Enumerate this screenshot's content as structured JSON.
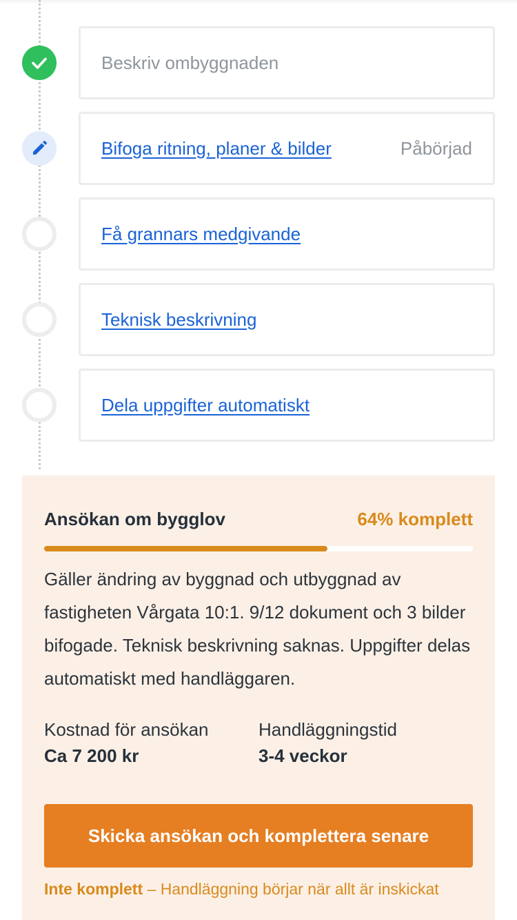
{
  "steps": [
    {
      "title": "Beskriv ombyggnaden",
      "status": "",
      "state": "done"
    },
    {
      "title": "Bifoga ritning, planer & bilder",
      "status": "Påbörjad",
      "state": "active"
    },
    {
      "title": "Få grannars medgivande",
      "status": "",
      "state": "todo"
    },
    {
      "title": "Teknisk beskrivning",
      "status": "",
      "state": "todo"
    },
    {
      "title": "Dela uppgifter automatiskt",
      "status": "",
      "state": "todo"
    }
  ],
  "summary": {
    "title": "Ansökan om bygglov",
    "percent_label": "64% komplett",
    "progress": 0.66,
    "description": "Gäller ändring av byggnad och utbyggnad av fastigheten Vårgata 10:1. 9/12 dokument och 3 bilder bifogade. Teknisk beskrivning saknas. Uppgifter delas automatiskt med handläggaren.",
    "cost_label": "Kostnad för ansökan",
    "cost_value": "Ca 7 200 kr",
    "time_label": "Handläggningstid",
    "time_value": "3-4 veckor",
    "submit_label": "Skicka ansökan och komplettera senare",
    "note_strong": "Inte komplett",
    "note_text": " – Handläggning börjar när allt är inskickat"
  },
  "icons": {
    "done": "check-icon",
    "active": "pencil-icon",
    "todo": "empty-circle-icon"
  },
  "colors": {
    "link": "#1a63d6",
    "done": "#2fbf5c",
    "accent": "#e67e22",
    "progress": "#d98a1d",
    "summary_bg": "#fcf0e6"
  }
}
